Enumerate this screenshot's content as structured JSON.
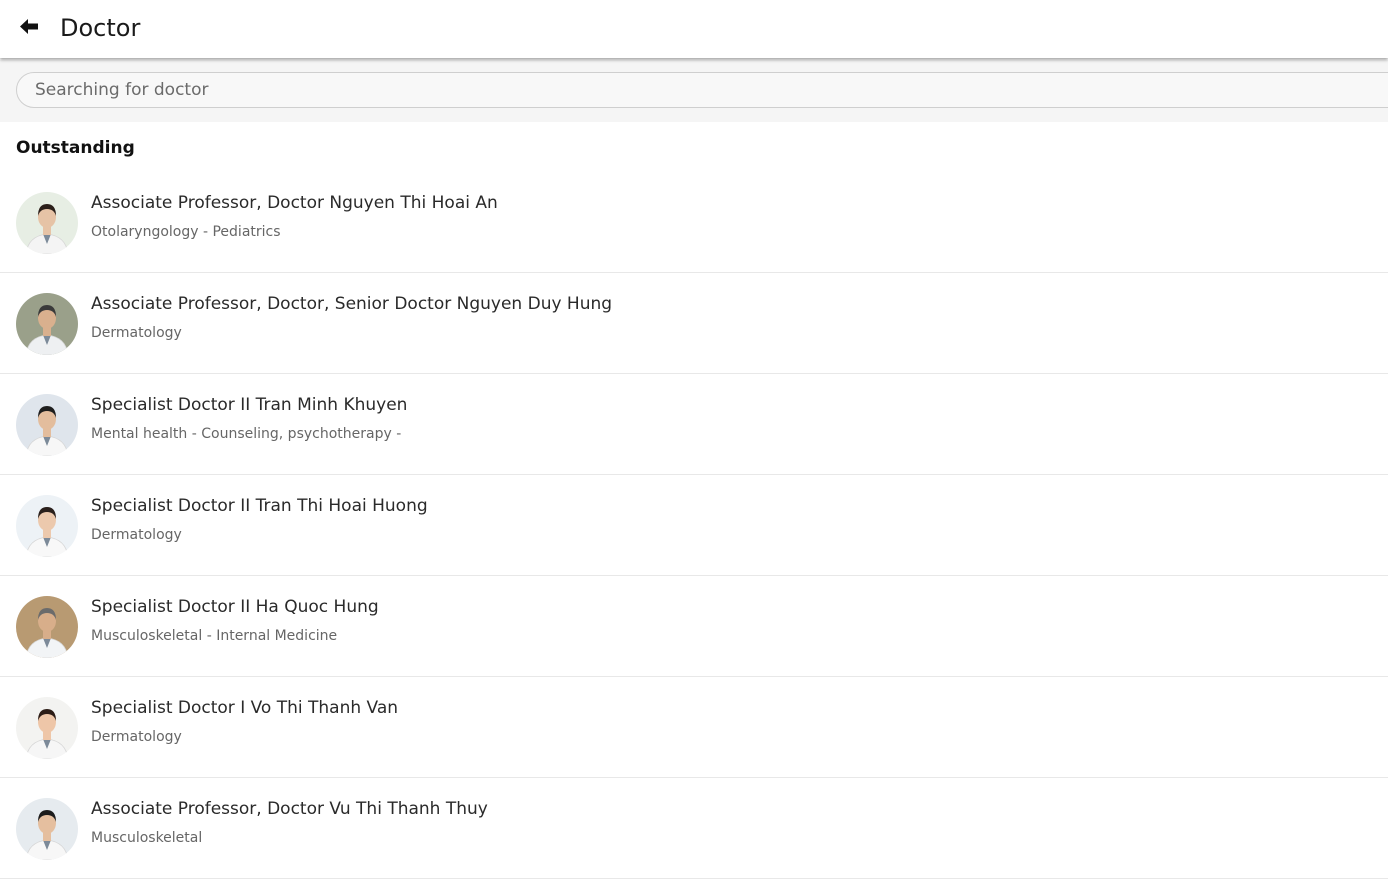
{
  "header": {
    "title": "Doctor",
    "back_icon": "arrow-left-icon"
  },
  "search": {
    "placeholder": "Searching for doctor",
    "value": ""
  },
  "section": {
    "title": "Outstanding"
  },
  "doctors": [
    {
      "name": "Associate Professor, Doctor Nguyen Thi Hoai An",
      "specialty": "Otolaryngology - Pediatrics",
      "avatar_bg": "#e7eee4",
      "coat": "#f4f4f4",
      "hair": "#2b1f1a",
      "skin": "#e6c3a6"
    },
    {
      "name": "Associate Professor, Doctor, Senior Doctor Nguyen Duy Hung",
      "specialty": "Dermatology",
      "avatar_bg": "#9aa08a",
      "coat": "#eef0f2",
      "hair": "#3a3a3a",
      "skin": "#d9b08e"
    },
    {
      "name": "Specialist Doctor II Tran Minh Khuyen",
      "specialty": "Mental health - Counseling, psychotherapy -",
      "avatar_bg": "#dfe5ec",
      "coat": "#f7f7f7",
      "hair": "#1e1e1e",
      "skin": "#e3bd9d"
    },
    {
      "name": "Specialist Doctor II Tran Thi Hoai Huong",
      "specialty": "Dermatology",
      "avatar_bg": "#edf2f6",
      "coat": "#f8f8f8",
      "hair": "#2a201c",
      "skin": "#ecc9ad"
    },
    {
      "name": "Specialist Doctor II Ha Quoc Hung",
      "specialty": "Musculoskeletal - Internal Medicine",
      "avatar_bg": "#b89a72",
      "coat": "#f2f4f6",
      "hair": "#6b6b6b",
      "skin": "#d8ae8a"
    },
    {
      "name": "Specialist Doctor I Vo Thi Thanh Van",
      "specialty": "Dermatology",
      "avatar_bg": "#f3f3f1",
      "coat": "#f6f6f6",
      "hair": "#2c1c16",
      "skin": "#eec6a8"
    },
    {
      "name": "Associate Professor, Doctor Vu Thi Thanh Thuy",
      "specialty": "Musculoskeletal",
      "avatar_bg": "#e6ebef",
      "coat": "#f7f7f7",
      "hair": "#1c1c1c",
      "skin": "#e5bf9f"
    }
  ]
}
